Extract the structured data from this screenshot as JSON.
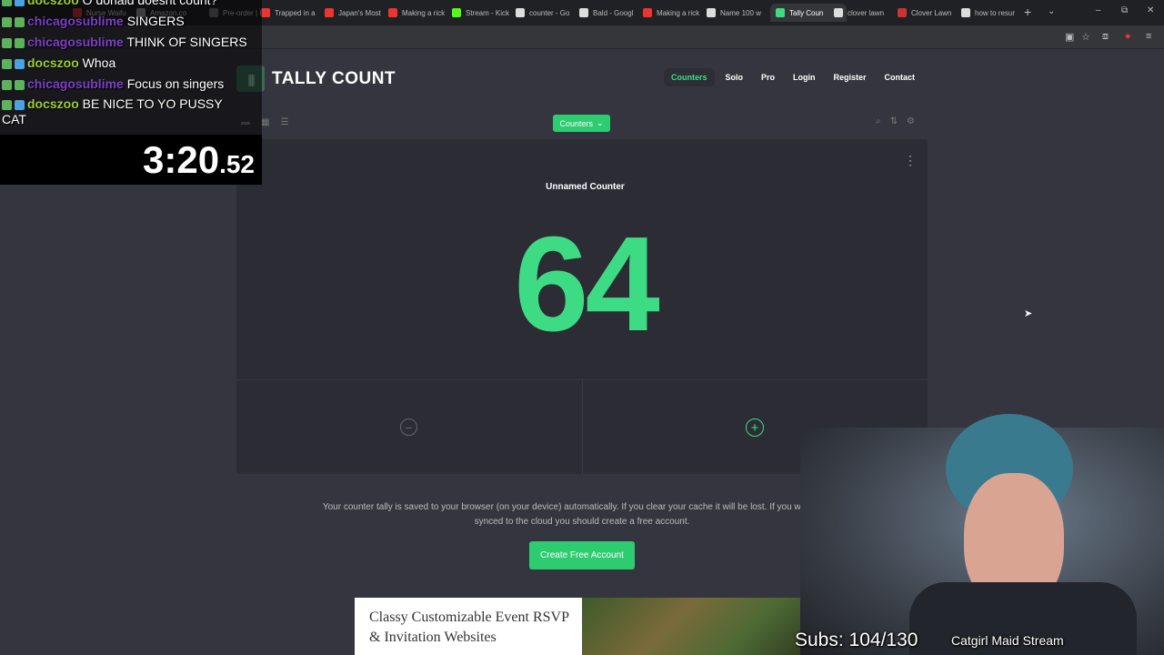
{
  "browser": {
    "tabs": [
      {
        "label": "Nurse Waifu",
        "color": "#b33"
      },
      {
        "label": "Amazon.co",
        "color": "#888"
      },
      {
        "label": "Pre-order | L",
        "color": "#666"
      },
      {
        "label": "Trapped in a",
        "color": "#e33"
      },
      {
        "label": "Japan's Most",
        "color": "#e33"
      },
      {
        "label": "Making a rick",
        "color": "#e33"
      },
      {
        "label": "Stream - Kick",
        "color": "#53fc18"
      },
      {
        "label": "counter - Go",
        "color": "#ddd"
      },
      {
        "label": "Bald - Googl",
        "color": "#ddd"
      },
      {
        "label": "Making a rick",
        "color": "#e33"
      },
      {
        "label": "Name 100 w",
        "color": "#ddd"
      },
      {
        "label": "Tally Coun",
        "color": "#3ddc84",
        "active": true
      },
      {
        "label": "clover lawn",
        "color": "#ddd"
      },
      {
        "label": "Clover Lawn",
        "color": "#c33"
      },
      {
        "label": "how to resur",
        "color": "#ddd"
      }
    ],
    "new_tab_icon": "+",
    "tab_list_icon": "⌄",
    "minimize_icon": "–",
    "restore_icon": "⧉",
    "close_icon": "✕"
  },
  "site": {
    "logo_text": "TALLY COUNT",
    "logo_icon": "||||",
    "nav": [
      {
        "label": "Counters",
        "active": true
      },
      {
        "label": "Solo"
      },
      {
        "label": "Pro"
      },
      {
        "label": "Login"
      },
      {
        "label": "Register"
      },
      {
        "label": "Contact"
      }
    ],
    "counters_dropdown": "Counters",
    "counter": {
      "name": "Unnamed Counter",
      "value": "64",
      "menu_icon": "⋮",
      "decrement_icon": "−",
      "increment_icon": "+"
    },
    "info_text": "Your counter tally is saved to your browser (on your device) automatically. If you clear your cache it will be lost. If you would like it synced to the cloud you should create a free account.",
    "create_button": "Create Free Account",
    "ad_text": "Classy Customizable Event RSVP & Invitation Websites"
  },
  "overlay": {
    "chat": [
      {
        "user": "docszoo",
        "message": "O donald doesnt count?",
        "badge": "b-blue",
        "user_class": "u-zoo"
      },
      {
        "user": "chicagosublime",
        "message": "SINGERS",
        "badge": "b-green",
        "user_class": "u-chi"
      },
      {
        "user": "chicagosublime",
        "message": "THINK OF SINGERS",
        "badge": "b-green",
        "user_class": "u-chi"
      },
      {
        "user": "docszoo",
        "message": "Whoa",
        "badge": "b-blue",
        "user_class": "u-zoo"
      },
      {
        "user": "chicagosublime",
        "message": "Focus on singers",
        "badge": "b-green",
        "user_class": "u-chi"
      },
      {
        "user": "docszoo",
        "message": "BE NICE TO YO PUSSY",
        "badge": "b-blue",
        "user_class": "u-zoo"
      },
      {
        "user": "",
        "message": "CAT",
        "badge": "",
        "user_class": ""
      }
    ],
    "timer_main": "3:20",
    "timer_cs": ".52",
    "subs": "Subs: 104/130",
    "stream_title": "Catgirl Maid Stream"
  }
}
